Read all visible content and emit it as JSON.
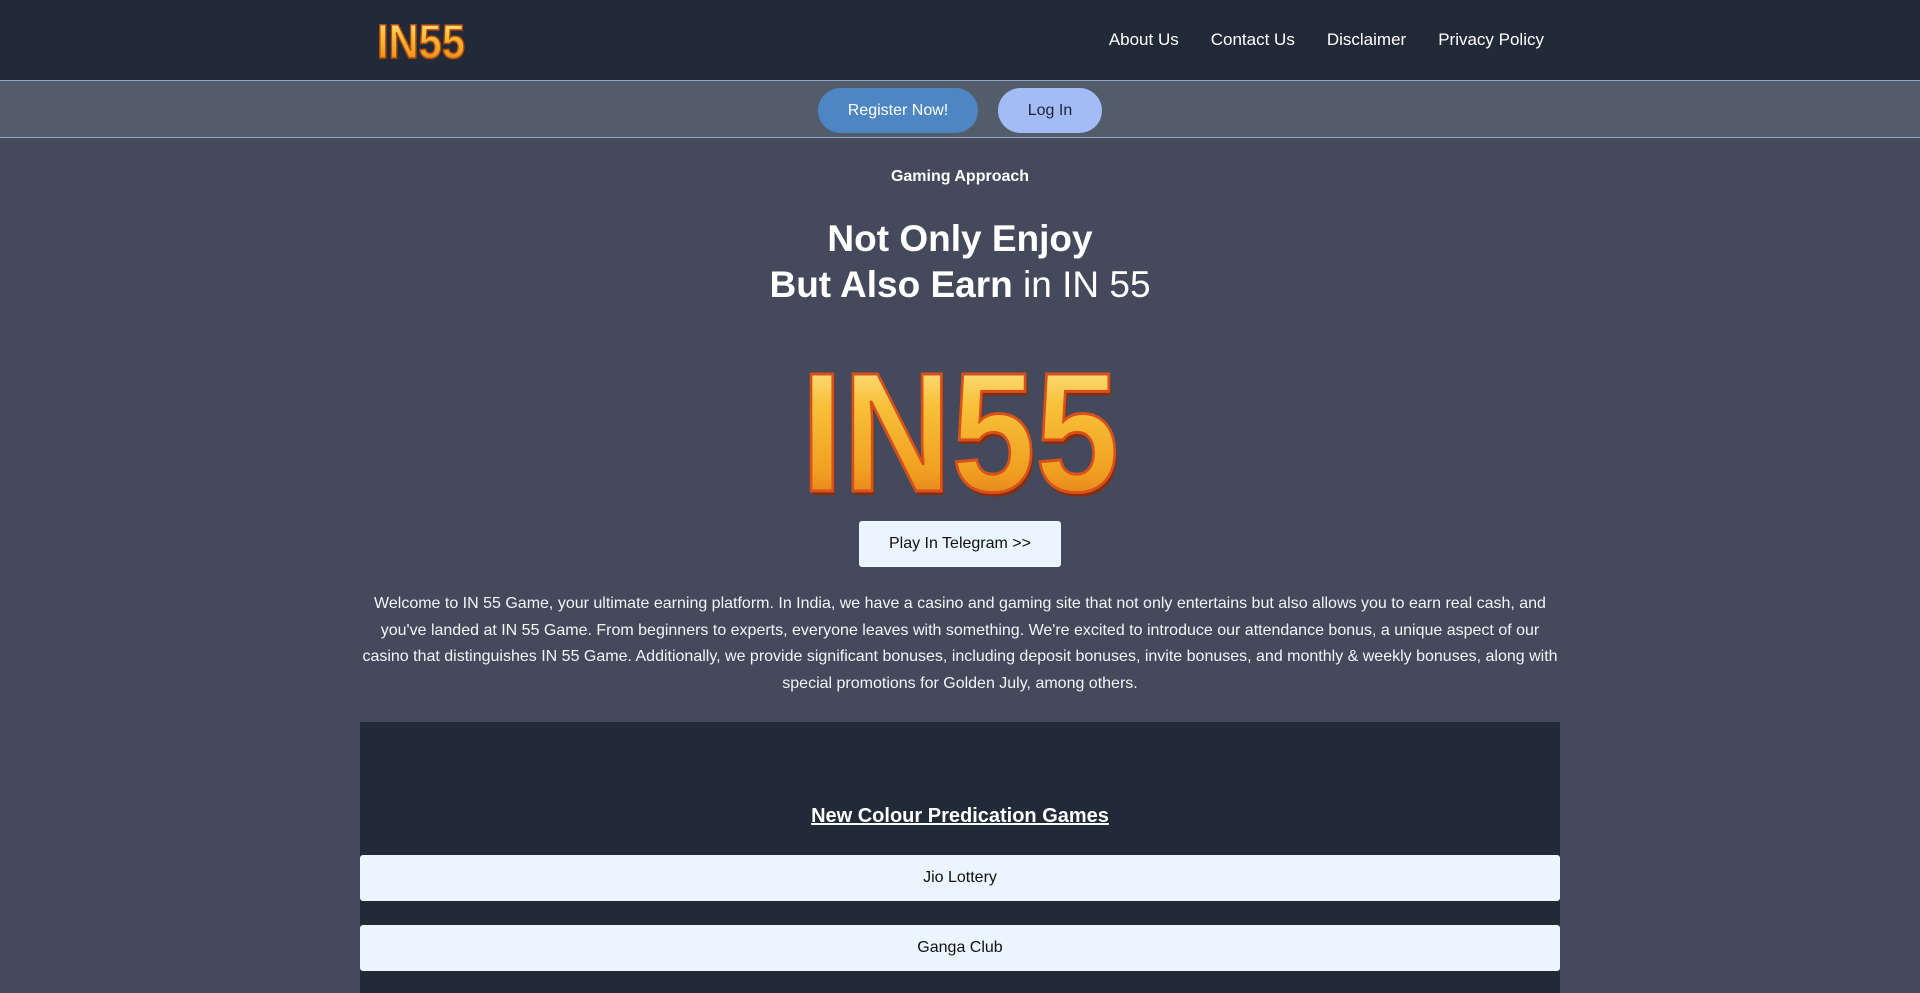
{
  "header": {
    "logo_text": "IN55",
    "nav": [
      "About Us",
      "Contact Us",
      "Disclaimer",
      "Privacy Policy"
    ]
  },
  "cta": {
    "register_label": "Register Now!",
    "login_label": "Log In"
  },
  "hero": {
    "kicker": "Gaming Approach",
    "headline_line1": "Not Only Enjoy",
    "headline_line2_bold": "But Also Earn",
    "headline_line2_rest": " in IN 55",
    "logo_text": "IN55",
    "telegram_label": "Play In Telegram >>",
    "intro": "Welcome to IN 55 Game, your ultimate earning platform. In India, we have a casino and gaming site that not only entertains but also allows you to earn real cash, and you've landed at IN 55 Game. From beginners to experts, everyone leaves with something. We're excited to introduce our attendance bonus, a unique aspect of our casino that distinguishes IN 55 Game. Additionally, we provide significant bonuses, including deposit bonuses, invite bonuses, and monthly & weekly bonuses, along with special promotions for Golden July, among others."
  },
  "games": {
    "title": "New Colour Predication Games",
    "items": [
      "Jio Lottery",
      "Ganga Club"
    ]
  },
  "colors": {
    "page_bg": "#444a5c",
    "header_bg": "#222a38",
    "cta_strip_bg": "#525c6a",
    "register_bg": "#4e86c4",
    "login_bg": "#a4bcf6",
    "button_light_bg": "#eaf5ff",
    "logo_gold": "#f6b733",
    "logo_orange": "#d8501c"
  }
}
